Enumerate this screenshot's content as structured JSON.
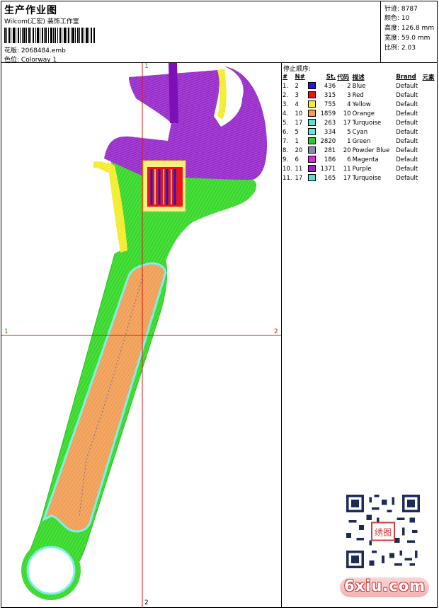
{
  "header": {
    "title": "生产作业图",
    "subtitle": "Wilcom(汇宏) 装饰工作室",
    "file_label": "花版:",
    "file_name": "2068484.emb",
    "colorway_label": "色位:",
    "colorway_name": "Colorway 1"
  },
  "stats": {
    "stitches_label": "针迹:",
    "stitches": "8787",
    "colors_label": "颜色:",
    "colors": "10",
    "height_label": "高度:",
    "height": "126.8 mm",
    "width_label": "宽度:",
    "width": "59.0 mm",
    "scale_label": "比例:",
    "scale": "2.03"
  },
  "stop_sequence": {
    "title": "停止顺序:",
    "headers": [
      "#",
      "N#",
      "St.",
      "代码",
      "描述",
      "Brand",
      "元素"
    ],
    "rows": [
      {
        "idx": "1.",
        "n": "2",
        "color": "#1a1ad9",
        "st": "436",
        "code": "2",
        "desc": "Blue",
        "brand": "Default"
      },
      {
        "idx": "2.",
        "n": "3",
        "color": "#e81616",
        "st": "315",
        "code": "3",
        "desc": "Red",
        "brand": "Default"
      },
      {
        "idx": "3.",
        "n": "4",
        "color": "#f5f020",
        "st": "755",
        "code": "4",
        "desc": "Yellow",
        "brand": "Default"
      },
      {
        "idx": "4.",
        "n": "10",
        "color": "#f0a050",
        "st": "1859",
        "code": "10",
        "desc": "Orange",
        "brand": "Default"
      },
      {
        "idx": "5.",
        "n": "17",
        "color": "#5ee0c8",
        "st": "263",
        "code": "17",
        "desc": "Turquoise",
        "brand": "Default"
      },
      {
        "idx": "6.",
        "n": "5",
        "color": "#60e6e6",
        "st": "334",
        "code": "5",
        "desc": "Cyan",
        "brand": "Default"
      },
      {
        "idx": "7.",
        "n": "1",
        "color": "#22d02a",
        "st": "2820",
        "code": "1",
        "desc": "Green",
        "brand": "Default"
      },
      {
        "idx": "8.",
        "n": "20",
        "color": "#8a8ab0",
        "st": "281",
        "code": "20",
        "desc": "Powder Blue",
        "brand": "Default"
      },
      {
        "idx": "9.",
        "n": "6",
        "color": "#e026e0",
        "st": "186",
        "code": "6",
        "desc": "Magenta",
        "brand": "Default"
      },
      {
        "idx": "10.",
        "n": "11",
        "color": "#9a24c8",
        "st": "1371",
        "code": "11",
        "desc": "Purple",
        "brand": "Default"
      },
      {
        "idx": "11.",
        "n": "17",
        "color": "#5ee0c8",
        "st": "165",
        "code": "17",
        "desc": "Turquoise",
        "brand": "Default"
      }
    ]
  },
  "axes": {
    "top_label": "1",
    "bottom_label": "2",
    "left_label": "1",
    "right_label": "2"
  },
  "watermark": {
    "text": "6xiu.com",
    "seal_text": "绣图"
  },
  "colors": {
    "axis": "#e01818",
    "purple": "#9a24c8",
    "green": "#5ed832",
    "bright_green": "#32e632",
    "orange": "#f0a050",
    "yellow": "#f5f020",
    "cyan": "#7ef0e8"
  }
}
